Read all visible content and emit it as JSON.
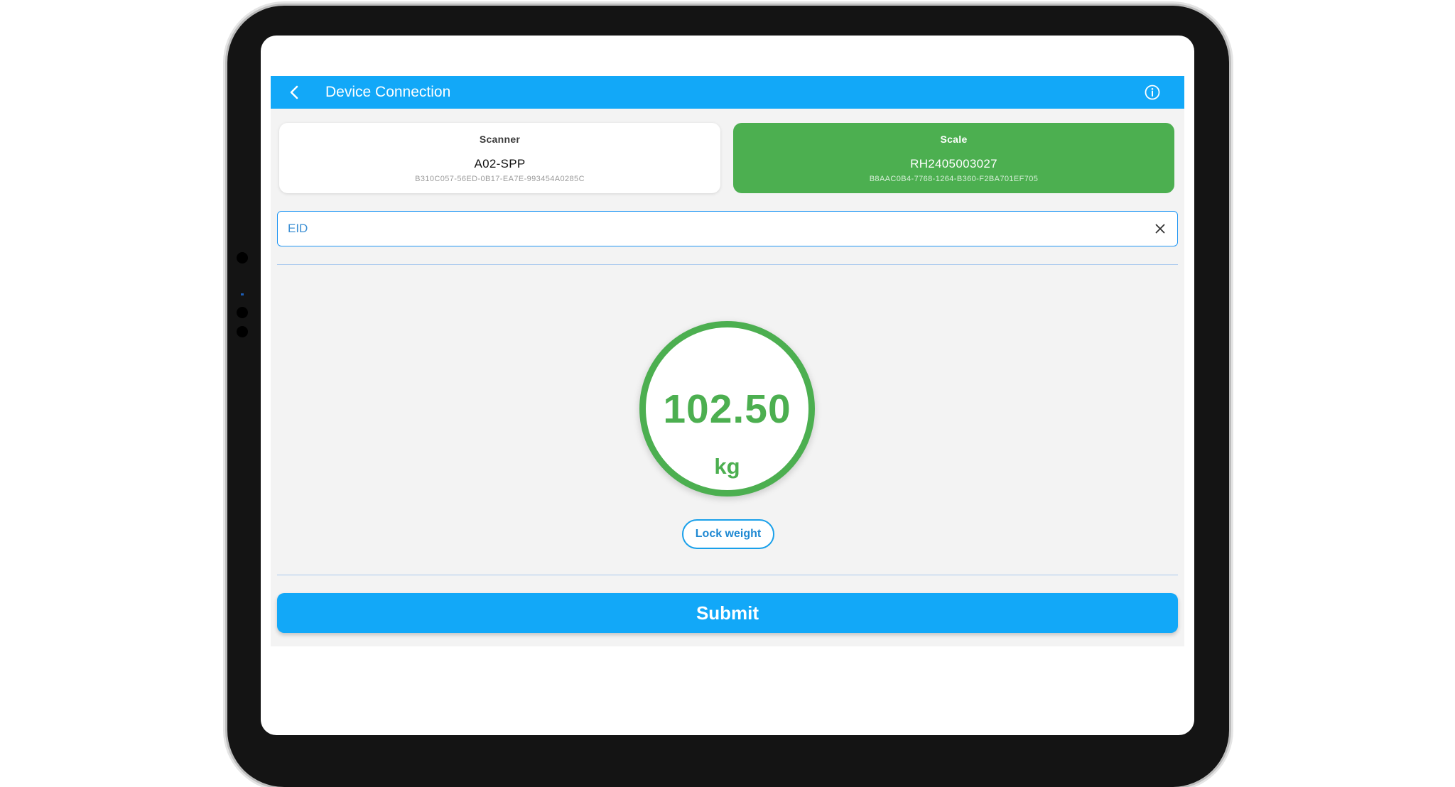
{
  "appbar": {
    "title": "Device Connection"
  },
  "devices": {
    "scanner": {
      "type_label": "Scanner",
      "name": "A02-SPP",
      "uuid": "B310C057-56ED-0B17-EA7E-993454A0285C"
    },
    "scale": {
      "type_label": "Scale",
      "name": "RH2405003027",
      "uuid": "B8AAC0B4-7768-1264-B360-F2BA701EF705"
    }
  },
  "eid": {
    "placeholder": "EID",
    "value": ""
  },
  "weight": {
    "value": "102.50",
    "unit": "kg"
  },
  "actions": {
    "lock_weight_label": "Lock weight",
    "submit_label": "Submit"
  },
  "colors": {
    "primary": "#12a8f8",
    "connected": "#4caf50",
    "outline": "#2196f3"
  },
  "icons": {
    "back": "chevron-left-icon",
    "info": "info-circle-icon",
    "clear": "close-icon"
  }
}
